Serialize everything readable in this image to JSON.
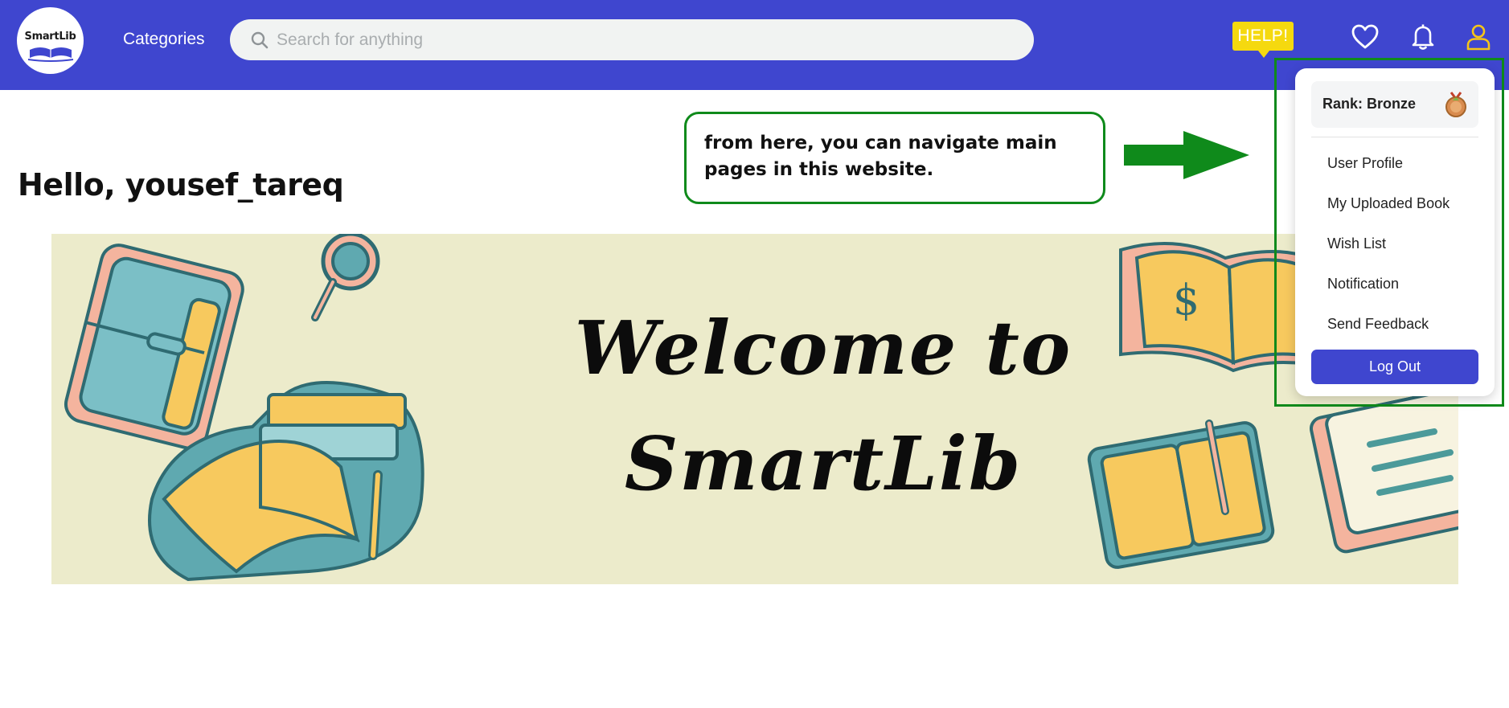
{
  "header": {
    "logo_text": "SmartLib",
    "categories_label": "Categories",
    "search": {
      "placeholder": "Search for anything",
      "value": ""
    },
    "help_label": "HELP!",
    "icons": [
      "heart-icon",
      "bell-icon",
      "user-icon"
    ],
    "colors": {
      "bar": "#3f46cf",
      "help": "#f5d90f",
      "user_icon": "#f5c518"
    }
  },
  "greeting": {
    "prefix": "Hello, ",
    "username": "yousef_tareq"
  },
  "annotation": {
    "text": "from here, you can navigate main pages in this website.",
    "color": "#0f8a1b"
  },
  "banner": {
    "title_line1": "Welcome to",
    "title_line2": "SmartLib",
    "background": "#ecebcb"
  },
  "user_menu": {
    "rank_label": "Rank: Bronze",
    "items": [
      {
        "label": "User Profile"
      },
      {
        "label": "My Uploaded Book"
      },
      {
        "label": "Wish List"
      },
      {
        "label": "Notification"
      },
      {
        "label": "Send Feedback"
      }
    ],
    "logout_label": "Log Out"
  }
}
